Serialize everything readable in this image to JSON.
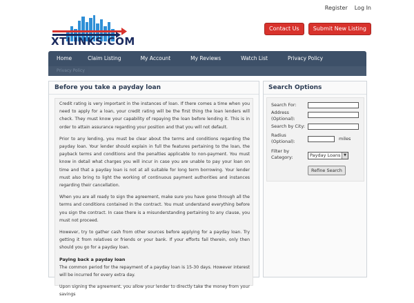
{
  "header": {
    "register": "Register",
    "login": "Log In",
    "logo_text": "XTLINKS.COM",
    "contact_us": "Contact Us",
    "submit_listing": "Submit New Listing"
  },
  "nav": {
    "items": [
      "Home",
      "Claim Listing",
      "My Account",
      "My Reviews",
      "Watch List",
      "Privacy Policy"
    ],
    "sub": "Privacy Policy"
  },
  "main": {
    "title": "Before you take a payday loan",
    "paragraphs": [
      "Credit rating is very important in the instances of loan. If there comes a time when you need to apply for a loan, your credit rating will be the first thing the loan lenders will check. They must know your capability of repaying the loan before lending it. This is in order to attain assurance regarding your position and that you will not default.",
      "Prior to any lending, you must be clear about the terms and conditions regarding the payday loan. Your lender should explain in full the features pertaining to the loan, the payback terms and conditions and the penalties applicable to non-payment. You must know in detail what charges you will incur in case you are unable to pay your loan on time and that a payday loan is not at all suitable for long term borrowing. Your lender must also bring to light the working of continuous payment authorities and instances regarding their cancellation.",
      "When you are all ready to sign the agreement, make sure you have gone through all the terms and conditions contained in the contract. You must understand everything before you sign the contract. In case there is a misunderstanding pertaining to any clause, you must not proceed.",
      "However, try to gather cash from other sources before applying for a payday loan. Try getting it from relatives or friends or your bank. If your efforts fail therein, only then should you go for a payday loan."
    ],
    "subheading": "Paying back a payday loan",
    "paragraph5": "The common period for the repayment of a payday loan is 15-30 days. However interest will be incurred for every extra day.",
    "paragraph6": "Upon signing the agreement, you allow your lender to directly take the money from your savings"
  },
  "sidebar": {
    "title": "Search Options",
    "search_for": "Search For:",
    "address": "Address (Optional):",
    "city": "Search by City:",
    "radius": "Radius (Optional):",
    "miles": "miles",
    "category_label": "Filter by Category:",
    "category_value": "Payday Loans",
    "refine_button": "Refine Search"
  }
}
